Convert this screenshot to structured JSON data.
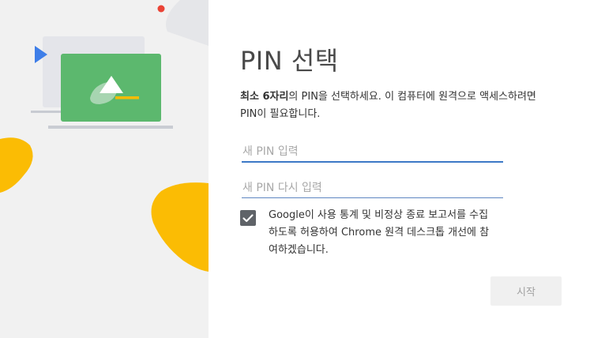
{
  "dialog": {
    "title": "PIN 선택",
    "description_bold": "최소 6자리",
    "description_rest": "의 PIN을 선택하세요. 이 컴퓨터에 원격으로 액세스하려면 PIN이 필요합니다."
  },
  "form": {
    "new_pin_placeholder": "새 PIN 입력",
    "confirm_pin_placeholder": "새 PIN 다시 입력",
    "new_pin_value": "",
    "confirm_pin_value": "",
    "consent_checked": true,
    "consent_text": "Google이 사용 통계 및 비정상 종료 보고서를 수집하도록 허용하여 Chrome 원격 데스크톱 개선에 참여하겠습니다."
  },
  "actions": {
    "start_label": "시작",
    "start_enabled": false
  },
  "colors": {
    "left_panel_bg": "#f1f1f1",
    "accent_blue": "#3c78c6",
    "illustration_green": "#5cb86e",
    "illustration_yellow": "#fbbc04",
    "notification_red": "#ea4335",
    "checkbox_bg": "#5f6368"
  },
  "illustration": {
    "icons": [
      "laptop-illustration",
      "monitor-illustration",
      "play-arrow-icon",
      "triangle-icon",
      "red-dot",
      "yellow-blob"
    ]
  }
}
